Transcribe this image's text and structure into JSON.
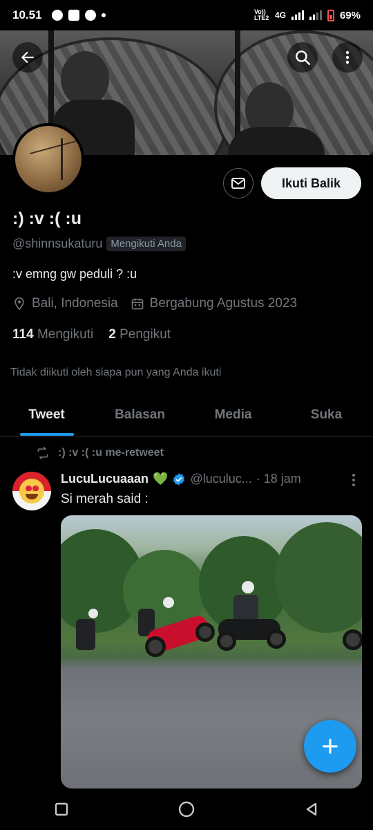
{
  "status_bar": {
    "time": "10.51",
    "network_label": "Vo)) LTE2",
    "network_type": "4G",
    "battery": "69%"
  },
  "banner": {
    "icons": [
      "back-arrow-icon",
      "search-icon",
      "more-vertical-icon"
    ]
  },
  "profile": {
    "display_name": ":) :v :( :u",
    "handle": "@shinnsukaturu",
    "follows_you_badge": "Mengikuti Anda",
    "bio": ":v emng gw peduli ? :u",
    "location": "Bali, Indonesia",
    "joined": "Bergabung Agustus 2023",
    "following_count": "114",
    "following_label": "Mengikuti",
    "followers_count": "2",
    "followers_label": "Pengikut",
    "not_followed_note": "Tidak diikuti oleh siapa pun yang Anda ikuti",
    "follow_back_label": "Ikuti Balik"
  },
  "tabs": [
    {
      "label": "Tweet",
      "active": true
    },
    {
      "label": "Balasan",
      "active": false
    },
    {
      "label": "Media",
      "active": false
    },
    {
      "label": "Suka",
      "active": false
    }
  ],
  "tweet": {
    "retweet_note": ":) :v :( :u me-retweet",
    "author": "LucuLucuaaan",
    "author_emoji": "💚",
    "handle": "@luculuc...",
    "time": "· 18 jam",
    "text": "Si merah said :"
  },
  "colors": {
    "accent": "#1d9bf0",
    "background": "#000000",
    "muted_text": "#71767b",
    "primary_text": "#e7e9ea"
  }
}
